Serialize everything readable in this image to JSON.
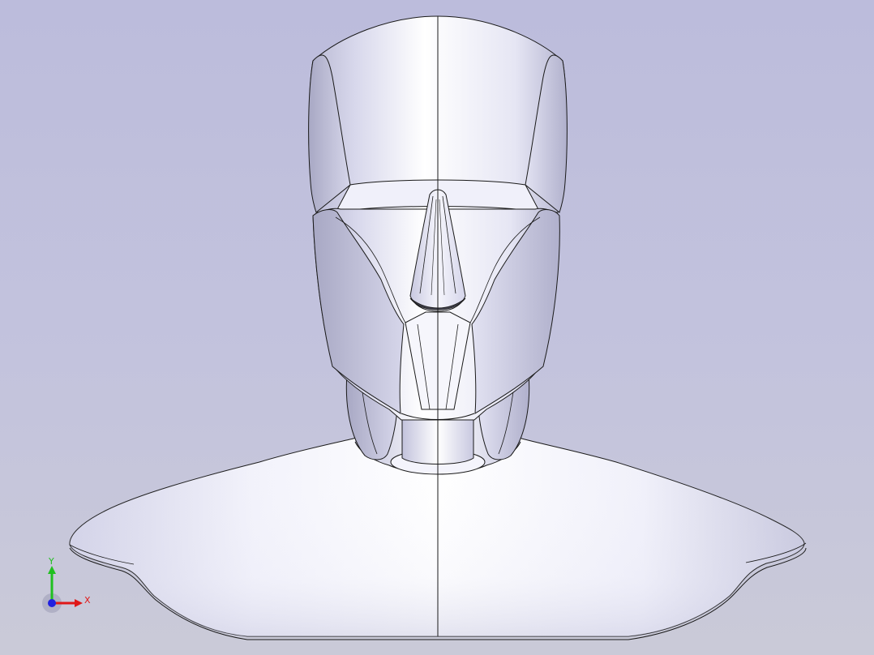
{
  "viewport": {
    "background_top": "#bcbcdc",
    "background_bottom": "#cacad8"
  },
  "model": {
    "name": "head-and-shoulders-bust",
    "edge_color": "#1a1a1a",
    "surface_color": "#e8e8f4"
  },
  "triad": {
    "x_label": "X",
    "y_label": "Y",
    "x_color": "#e01818",
    "y_color": "#20c020",
    "z_color": "#2020e0"
  }
}
